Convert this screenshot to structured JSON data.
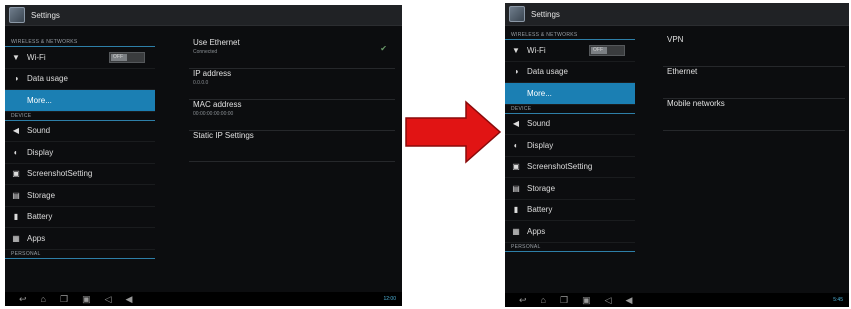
{
  "left": {
    "title": "Settings",
    "sections": [
      {
        "header": "WIRELESS & NETWORKS",
        "items": [
          {
            "label": "Wi-Fi",
            "icon": "wifi-icon",
            "glyph": "▼",
            "toggle": "OFF"
          },
          {
            "label": "Data usage",
            "icon": "data-usage-icon",
            "glyph": "◑"
          },
          {
            "label": "More...",
            "icon": "",
            "glyph": "",
            "selected": true
          }
        ]
      },
      {
        "header": "DEVICE",
        "items": [
          {
            "label": "Sound",
            "icon": "sound-icon",
            "glyph": "◀"
          },
          {
            "label": "Display",
            "icon": "display-icon",
            "glyph": "◐"
          },
          {
            "label": "ScreenshotSetting",
            "icon": "screenshot-icon",
            "glyph": "▣"
          },
          {
            "label": "Storage",
            "icon": "storage-icon",
            "glyph": "▤"
          },
          {
            "label": "Battery",
            "icon": "battery-icon",
            "glyph": "▮"
          },
          {
            "label": "Apps",
            "icon": "apps-icon",
            "glyph": "▦"
          }
        ]
      },
      {
        "header": "PERSONAL",
        "items": []
      }
    ],
    "detail": [
      {
        "title": "Use Ethernet",
        "subtitle": "Connected",
        "check": "✔"
      },
      {
        "title": "IP address",
        "subtitle": "0.0.0.0"
      },
      {
        "title": "MAC address",
        "subtitle": "00:00:00:00:00:00"
      },
      {
        "title": "Static IP Settings"
      }
    ],
    "status": "12:00"
  },
  "right": {
    "title": "Settings",
    "sections": [
      {
        "header": "WIRELESS & NETWORKS",
        "items": [
          {
            "label": "Wi-Fi",
            "icon": "wifi-icon",
            "glyph": "▼",
            "toggle": "OFF"
          },
          {
            "label": "Data usage",
            "icon": "data-usage-icon",
            "glyph": "◑"
          },
          {
            "label": "More...",
            "icon": "",
            "glyph": "",
            "selected": true
          }
        ]
      },
      {
        "header": "DEVICE",
        "items": [
          {
            "label": "Sound",
            "icon": "sound-icon",
            "glyph": "◀"
          },
          {
            "label": "Display",
            "icon": "display-icon",
            "glyph": "◐"
          },
          {
            "label": "ScreenshotSetting",
            "icon": "screenshot-icon",
            "glyph": "▣"
          },
          {
            "label": "Storage",
            "icon": "storage-icon",
            "glyph": "▤"
          },
          {
            "label": "Battery",
            "icon": "battery-icon",
            "glyph": "▮"
          },
          {
            "label": "Apps",
            "icon": "apps-icon",
            "glyph": "▦"
          }
        ]
      },
      {
        "header": "PERSONAL",
        "items": []
      }
    ],
    "detail": [
      {
        "title": "VPN"
      },
      {
        "title": "Ethernet"
      },
      {
        "title": "Mobile networks"
      }
    ],
    "status": "5:45"
  },
  "colors": {
    "accent": "#1b7fb3",
    "arrow": "#e11414",
    "background": "#0c0d0f"
  },
  "nav_icons": [
    "back-icon",
    "home-icon",
    "recent-apps-icon",
    "screenshot-icon",
    "volume-down-icon",
    "volume-up-icon"
  ]
}
